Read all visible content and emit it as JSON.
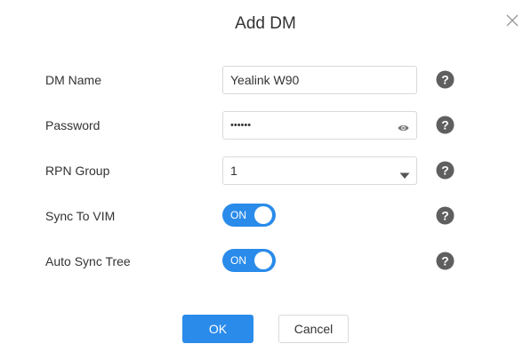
{
  "dialog": {
    "title": "Add DM"
  },
  "form": {
    "dm_name": {
      "label": "DM Name",
      "value": "Yealink W90"
    },
    "password": {
      "label": "Password",
      "masked_value": "••••••"
    },
    "rpn_group": {
      "label": "RPN Group",
      "selected": "1"
    },
    "sync_to_vim": {
      "label": "Sync To VIM",
      "state": "ON"
    },
    "auto_sync_tree": {
      "label": "Auto Sync Tree",
      "state": "ON"
    }
  },
  "buttons": {
    "ok_label": "OK",
    "cancel_label": "Cancel"
  },
  "colors": {
    "accent": "#2a8bea",
    "help_icon": "#5f5f5f"
  }
}
